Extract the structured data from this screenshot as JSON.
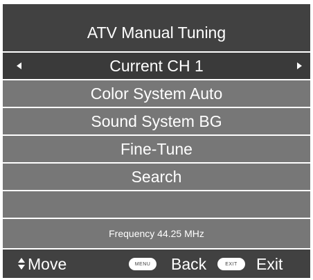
{
  "menu": {
    "title": "ATV Manual Tuning",
    "items": [
      {
        "label": "Current CH 1",
        "selected": true
      },
      {
        "label": "Color System Auto"
      },
      {
        "label": "Sound System BG"
      },
      {
        "label": "Fine-Tune"
      },
      {
        "label": "Search"
      },
      {
        "label": ""
      }
    ],
    "frequency": "Frequency 44.25 MHz"
  },
  "footer": {
    "move_label": "Move",
    "menu_key": "MENU",
    "back_label": "Back",
    "exit_key": "EXIT",
    "exit_label": "Exit"
  },
  "colors": {
    "header_bg": "#414141",
    "row_bg": "#777777",
    "selected_row_bg": "#3a3a3a",
    "text": "#ffffff"
  }
}
